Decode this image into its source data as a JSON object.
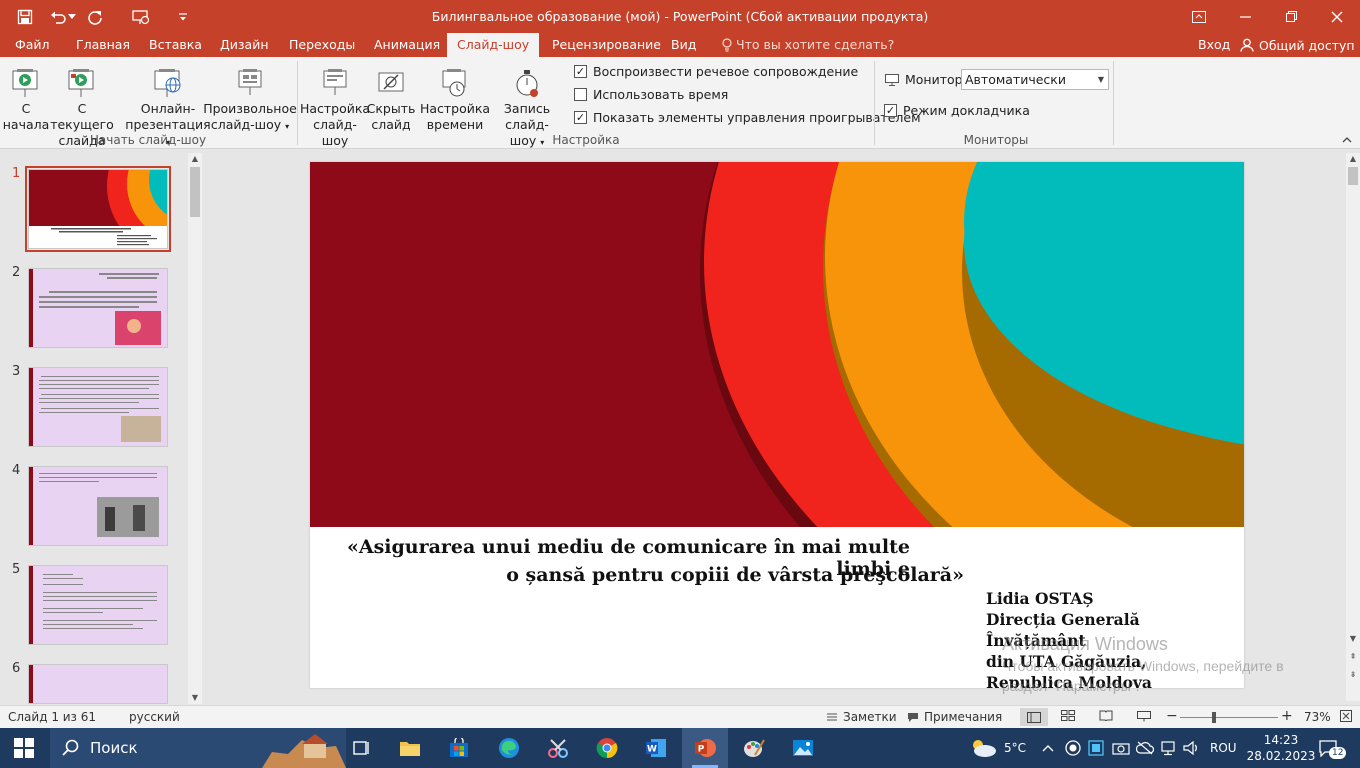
{
  "window": {
    "title": "Билингвальное образование (мой) - PowerPoint (Сбой активации продукта)",
    "accent": "#c5412a"
  },
  "ribbon_tabs": [
    "Файл",
    "Главная",
    "Вставка",
    "Дизайн",
    "Переходы",
    "Анимация",
    "Слайд-шоу",
    "Рецензирование",
    "Вид"
  ],
  "active_tab": "Слайд-шоу",
  "tell_me": "Что вы хотите сделать?",
  "signin": "Вход",
  "share": "Общий доступ",
  "ribbon": {
    "start": {
      "from_beginning": [
        "С",
        "начала"
      ],
      "from_current": [
        "С текущего",
        "слайда"
      ],
      "online": [
        "Онлайн-",
        "презентация"
      ],
      "custom": [
        "Произвольное",
        "слайд-шоу"
      ],
      "group_label": "Начать слайд-шоу"
    },
    "setup": {
      "setup_show": [
        "Настройка",
        "слайд-шоу"
      ],
      "hide_slide": [
        "Скрыть",
        "слайд"
      ],
      "rehearse": [
        "Настройка",
        "времени"
      ],
      "record": [
        "Запись слайд-",
        "шоу"
      ],
      "play_narrations": "Воспроизвести речевое сопровождение",
      "use_timings": "Использовать время",
      "show_media_controls": "Показать элементы управления проигрывателем",
      "play_narrations_checked": true,
      "use_timings_checked": false,
      "show_media_controls_checked": true,
      "group_label": "Настройка"
    },
    "monitors": {
      "monitor_label": "Монитор:",
      "monitor_value": "Автоматически",
      "presenter_view": "Режим докладчика",
      "presenter_view_checked": true,
      "group_label": "Мониторы"
    }
  },
  "thumbnails": {
    "numbers": [
      "1",
      "2",
      "3",
      "4",
      "5",
      "6"
    ],
    "selected": "1"
  },
  "slide": {
    "title_line1": "«Asigurarea unui mediu de comunicare în mai multe limbi e",
    "title_line2": "o șansă pentru copiii de vârsta preşcolară»",
    "author_lines": [
      "Lidia OSTAȘ",
      "Direcția Generală Învățământ",
      "din UTA Găgăuzia,",
      "Republica Moldova"
    ],
    "colors": {
      "dark_red": "#8e0a18",
      "red": "#f1231d",
      "orange": "#f7940a",
      "teal": "#02bcbc"
    }
  },
  "watermark": {
    "line1": "Активация Windows",
    "line2": "Чтобы активировать Windows, перейдите в",
    "line3": "раздел \"Параметры\"."
  },
  "statusbar": {
    "slide_info": "Слайд 1 из 61",
    "language": "русский",
    "notes": "Заметки",
    "comments": "Примечания",
    "zoom": "73%",
    "zoom_level": 0.73
  },
  "taskbar": {
    "search": "Поиск",
    "weather": "5°C",
    "lang": "ROU",
    "time": "14:23",
    "date": "28.02.2023",
    "notifications": "12"
  }
}
